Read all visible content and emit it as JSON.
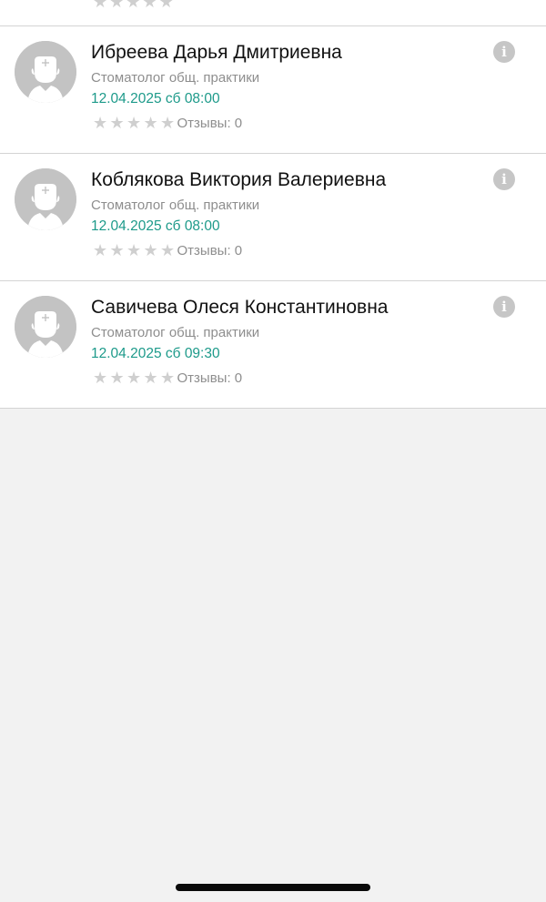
{
  "colors": {
    "slot_time": "#1d9a8a",
    "avatar_bg": "#c3c3c3",
    "star_empty": "#cfcfcf"
  },
  "doctors": [
    {
      "name": "Ибреева Дарья Дмитриевна",
      "specialty": "Стоматолог общ. практики",
      "slot": "12.04.2025 сб 08:00",
      "reviews": "Отзывы: 0",
      "rating": 0,
      "info_icon": "info-icon"
    },
    {
      "name": "Коблякова Виктория Валериевна",
      "specialty": "Стоматолог общ. практики",
      "slot": "12.04.2025 сб 08:00",
      "reviews": "Отзывы: 0",
      "rating": 0,
      "info_icon": "info-icon"
    },
    {
      "name": "Савичева Олеся Константиновна",
      "specialty": "Стоматолог общ. практики",
      "slot": "12.04.2025 сб 09:30",
      "reviews": "Отзывы: 0",
      "rating": 0,
      "info_icon": "info-icon"
    }
  ],
  "icons": {
    "info_glyph": "i",
    "star_glyph": "★"
  }
}
